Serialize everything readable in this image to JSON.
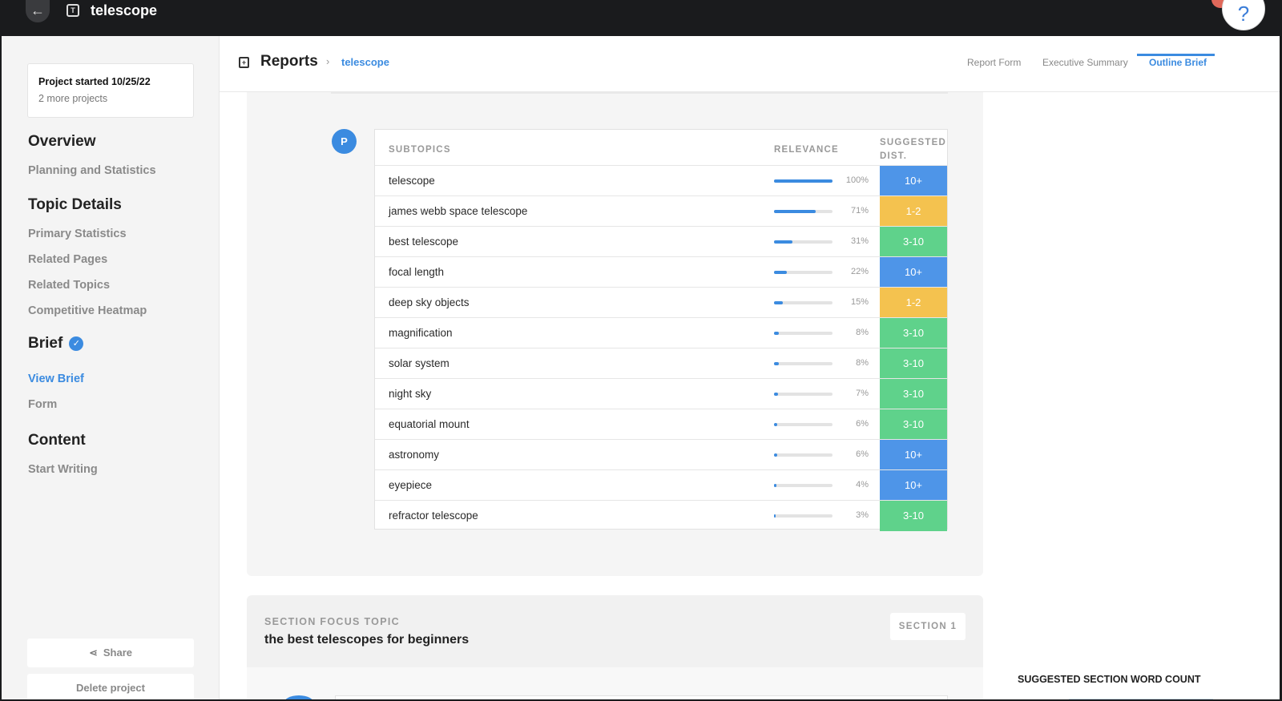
{
  "topbar": {
    "title": "telescope",
    "help_label": "?"
  },
  "sidebar": {
    "project_started": "Project started 10/25/22",
    "more_projects": "2 more projects",
    "overview": {
      "heading": "Overview",
      "items": [
        "Planning and Statistics"
      ]
    },
    "topic_details": {
      "heading": "Topic Details",
      "items": [
        "Primary Statistics",
        "Related Pages",
        "Related Topics",
        "Competitive Heatmap"
      ]
    },
    "brief": {
      "heading": "Brief",
      "items": [
        "View Brief",
        "Form"
      ]
    },
    "content": {
      "heading": "Content",
      "items": [
        "Start Writing"
      ]
    },
    "share_label": "Share",
    "delete_label": "Delete project"
  },
  "header": {
    "title": "Reports",
    "breadcrumb_separator": "›",
    "breadcrumb": "telescope",
    "tabs": [
      "Report Form",
      "Executive Summary",
      "Outline Brief"
    ],
    "active_tab": "Outline Brief"
  },
  "avatar_letter": "P",
  "table": {
    "headers": {
      "subtopics": "SUBTOPICS",
      "relevance": "RELEVANCE",
      "suggested_line1": "SUGGESTED",
      "suggested_line2": "DIST."
    },
    "rows": [
      {
        "label": "telescope",
        "relevance": 100,
        "pct": "100%",
        "dist": "10+",
        "color": "blue"
      },
      {
        "label": "james webb space telescope",
        "relevance": 71,
        "pct": "71%",
        "dist": "1-2",
        "color": "yellow"
      },
      {
        "label": "best telescope",
        "relevance": 31,
        "pct": "31%",
        "dist": "3-10",
        "color": "green"
      },
      {
        "label": "focal length",
        "relevance": 22,
        "pct": "22%",
        "dist": "10+",
        "color": "blue"
      },
      {
        "label": "deep sky objects",
        "relevance": 15,
        "pct": "15%",
        "dist": "1-2",
        "color": "yellow"
      },
      {
        "label": "magnification",
        "relevance": 8,
        "pct": "8%",
        "dist": "3-10",
        "color": "green"
      },
      {
        "label": "solar system",
        "relevance": 8,
        "pct": "8%",
        "dist": "3-10",
        "color": "green"
      },
      {
        "label": "night sky",
        "relevance": 7,
        "pct": "7%",
        "dist": "3-10",
        "color": "green"
      },
      {
        "label": "equatorial mount",
        "relevance": 6,
        "pct": "6%",
        "dist": "3-10",
        "color": "green"
      },
      {
        "label": "astronomy",
        "relevance": 6,
        "pct": "6%",
        "dist": "10+",
        "color": "blue"
      },
      {
        "label": "eyepiece",
        "relevance": 4,
        "pct": "4%",
        "dist": "10+",
        "color": "blue"
      },
      {
        "label": "refractor telescope",
        "relevance": 3,
        "pct": "3%",
        "dist": "3-10",
        "color": "green"
      }
    ]
  },
  "colors": {
    "blue": "#4e95e8",
    "yellow": "#f4c24f",
    "green": "#5fd28b",
    "accent": "#3b8be0"
  },
  "section_focus": {
    "label": "SECTION FOCUS TOPIC",
    "title": "the best telescopes for beginners",
    "badge": "SECTION 1"
  },
  "word_count_title": "SUGGESTED SECTION WORD COUNT"
}
